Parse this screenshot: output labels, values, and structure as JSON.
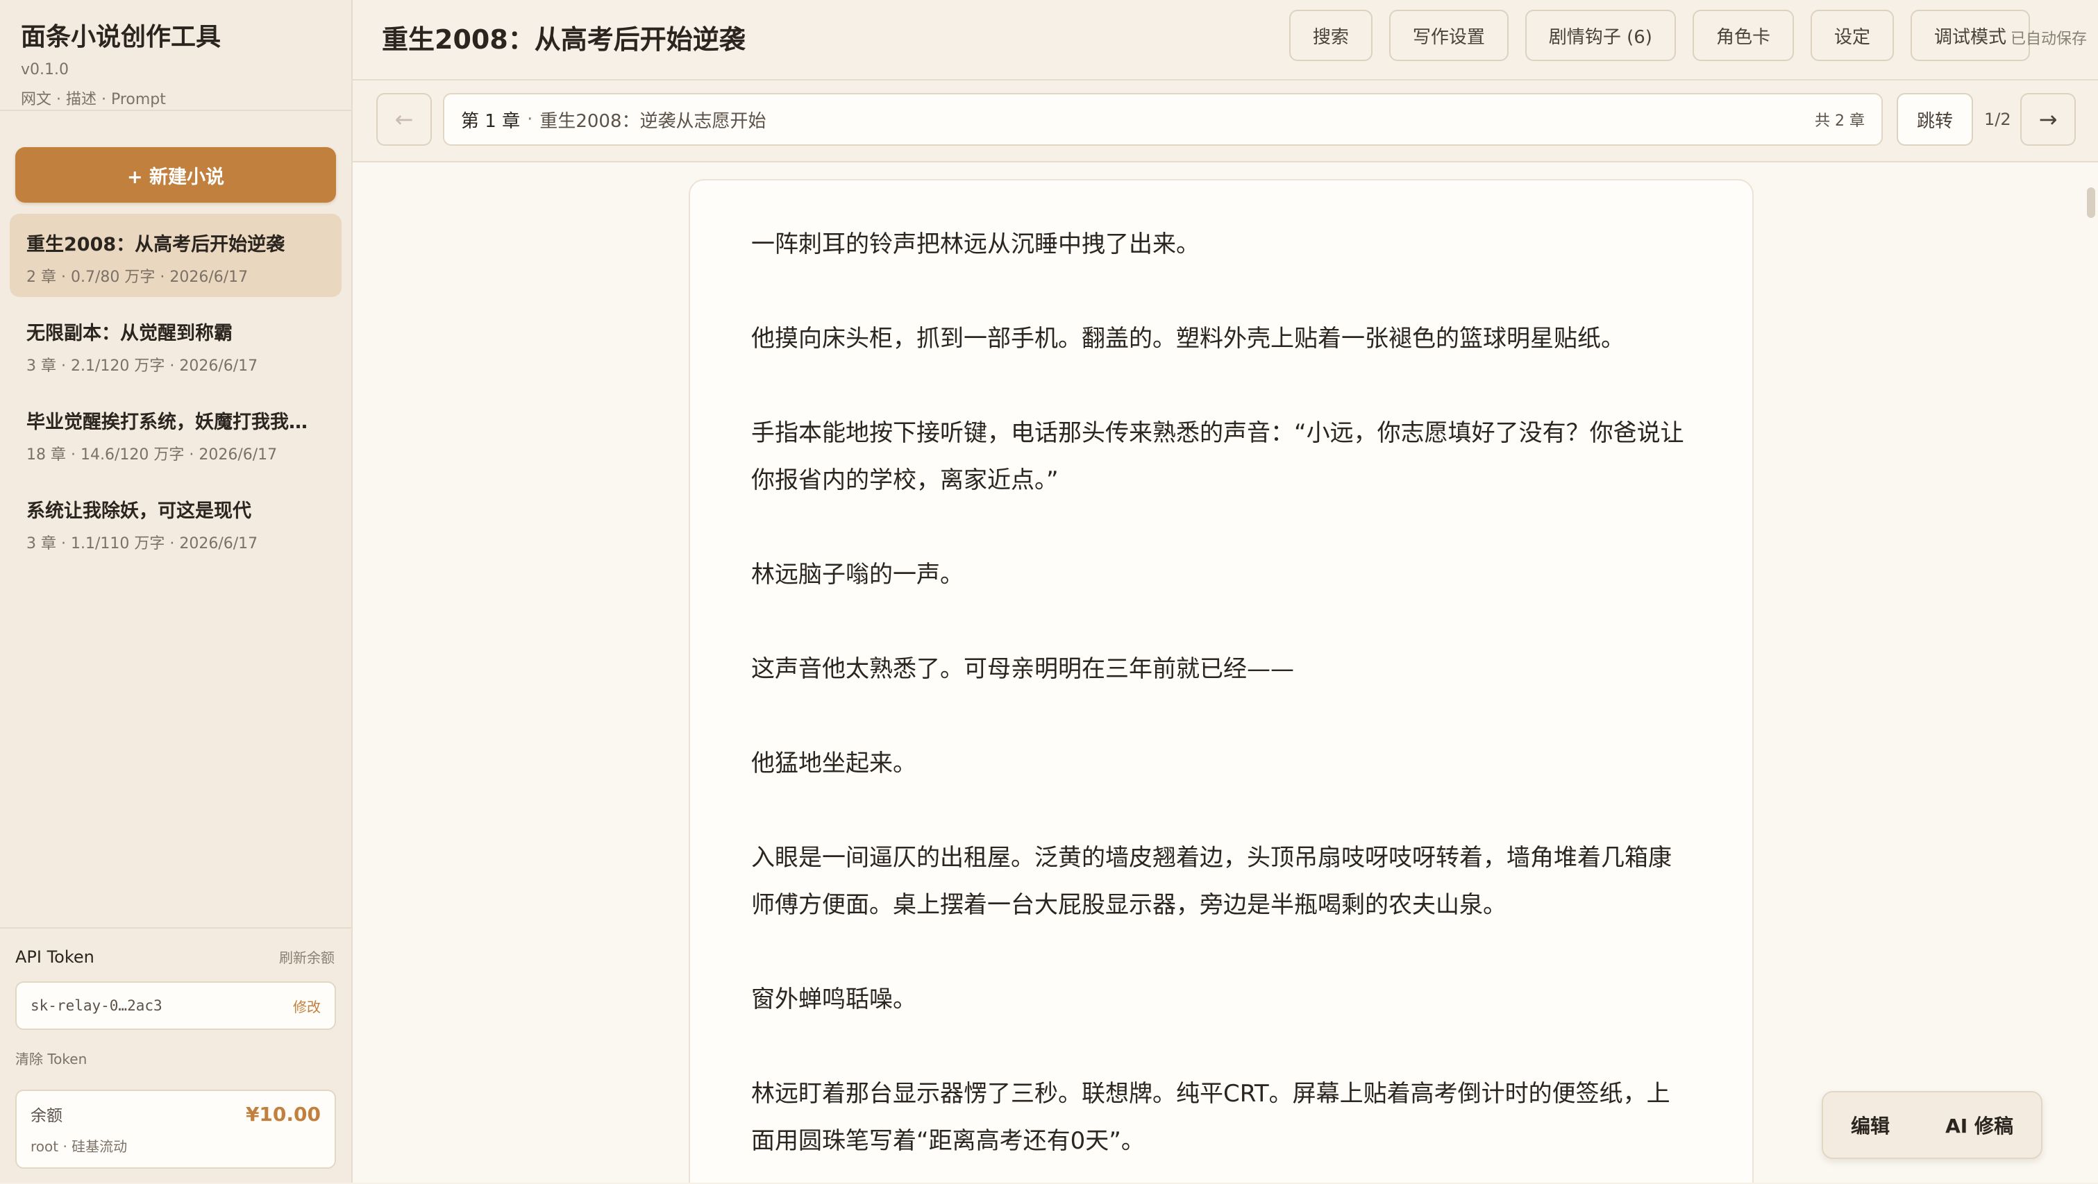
{
  "app": {
    "name": "面条小说创作工具",
    "version": "v0.1.0",
    "tags": "网文 · 描述 · Prompt"
  },
  "sidebar": {
    "new_button": "+ 新建小说",
    "novels": [
      {
        "title": "重生2008：从高考后开始逆袭",
        "meta": "2 章 · 0.7/80 万字 · 2026/6/17",
        "active": true
      },
      {
        "title": "无限副本：从觉醒到称霸",
        "meta": "3 章 · 2.1/120 万字 · 2026/6/17"
      },
      {
        "title": "毕业觉醒挨打系统，妖魔打我我…",
        "meta": "18 章 · 14.6/120 万字 · 2026/6/17"
      },
      {
        "title": "系统让我除妖，可这是现代",
        "meta": "3 章 · 1.1/110 万字 · 2026/6/17"
      }
    ],
    "token": {
      "label": "API Token",
      "refresh": "刷新余额",
      "value": "sk-relay-0…2ac3",
      "edit": "修改",
      "clear": "清除 Token"
    },
    "balance": {
      "label": "余额",
      "value": "¥10.00",
      "sub": "root · 硅基流动"
    }
  },
  "header": {
    "title": "重生2008：从高考后开始逆袭",
    "buttons": {
      "search": "搜索",
      "writing": "写作设置",
      "hooks": "剧情钩子 (6)",
      "cards": "角色卡",
      "settings": "设定",
      "debug": "调试模式"
    },
    "autosave": "已自动保存"
  },
  "chapter": {
    "prev": "←",
    "next": "→",
    "number": "第 1 章",
    "sep": "·",
    "name": "重生2008：逆袭从志愿开始",
    "total": "共 2 章",
    "jump": "跳转",
    "page": "1/2"
  },
  "content": {
    "paragraphs": [
      "一阵刺耳的铃声把林远从沉睡中拽了出来。",
      "他摸向床头柜，抓到一部手机。翻盖的。塑料外壳上贴着一张褪色的篮球明星贴纸。",
      "手指本能地按下接听键，电话那头传来熟悉的声音：“小远，你志愿填好了没有？你爸说让你报省内的学校，离家近点。”",
      "林远脑子嗡的一声。",
      "这声音他太熟悉了。可母亲明明在三年前就已经——",
      "他猛地坐起来。",
      "入眼是一间逼仄的出租屋。泛黄的墙皮翘着边，头顶吊扇吱呀吱呀转着，墙角堆着几箱康师傅方便面。桌上摆着一台大屁股显示器，旁边是半瓶喝剩的农夫山泉。",
      "窗外蝉鸣聒噪。",
      "林远盯着那台显示器愣了三秒。联想牌。纯平CRT。屏幕上贴着高考倒计时的便签纸，上面用圆珠笔写着“距离高考还有0天”。"
    ]
  },
  "float": {
    "edit": "编辑",
    "ai_revise": "AI 修稿"
  }
}
